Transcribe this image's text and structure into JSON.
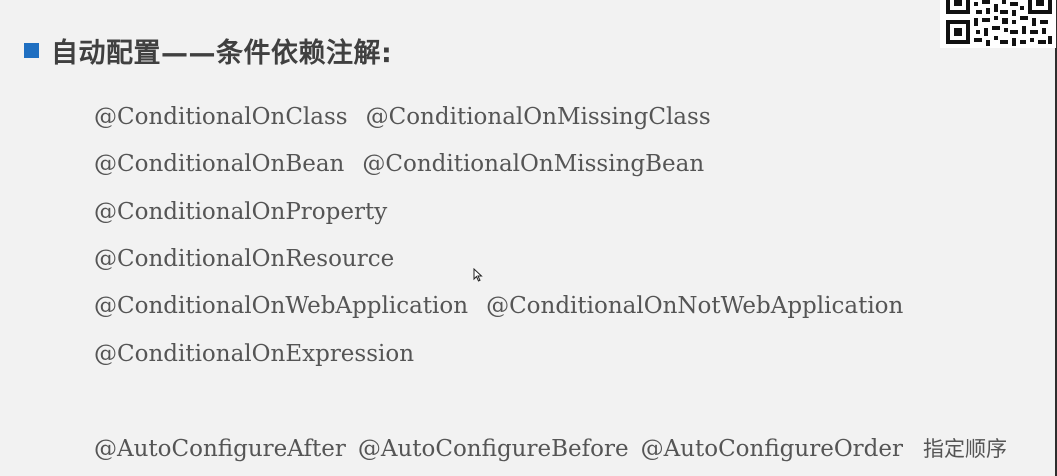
{
  "slide": {
    "title": "自动配置——条件依赖注解:",
    "accent_color": "#1f6fc1",
    "rows": [
      [
        "@ConditionalOnClass",
        "@ConditionalOnMissingClass"
      ],
      [
        "@ConditionalOnBean",
        "@ConditionalOnMissingBean"
      ],
      [
        "@ConditionalOnProperty"
      ],
      [
        "@ConditionalOnResource"
      ],
      [
        "@ConditionalOnWebApplication",
        "@ConditionalOnNotWebApplication"
      ],
      [
        "@ConditionalOnExpression"
      ]
    ],
    "order_row": {
      "items": [
        "@AutoConfigureAfter",
        "@AutoConfigureBefore",
        "@AutoConfigureOrder"
      ],
      "note": "指定顺序"
    }
  },
  "icons": {
    "qr": "qr-code-icon",
    "cursor": "mouse-pointer-icon"
  }
}
